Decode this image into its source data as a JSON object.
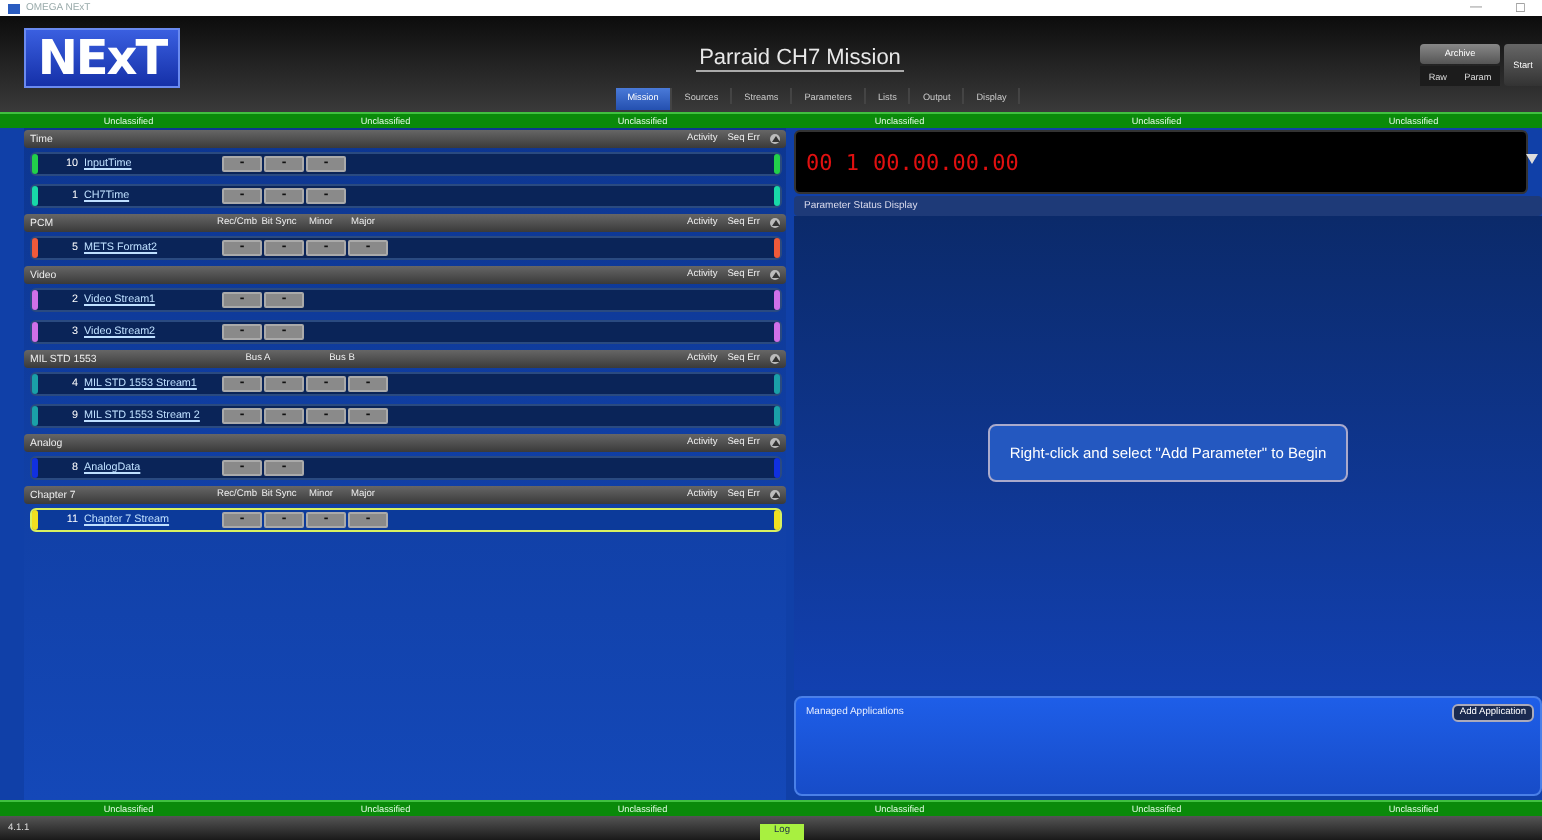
{
  "window": {
    "title": "OMEGA NExT",
    "controls": [
      "—",
      "☐"
    ]
  },
  "header": {
    "logo": "NExT",
    "mission_title": "Parraid CH7 Mission",
    "tabs": [
      {
        "label": "Mission",
        "selected": true
      },
      {
        "label": "Sources",
        "selected": false
      },
      {
        "label": "Streams",
        "selected": false
      },
      {
        "label": "Parameters",
        "selected": false
      },
      {
        "label": "Lists",
        "selected": false
      },
      {
        "label": "Output",
        "selected": false
      },
      {
        "label": "Display",
        "selected": false
      }
    ],
    "archive_button": "Archive",
    "raw_button": "Raw",
    "param_button": "Param",
    "start_button": "Start"
  },
  "classification_top": [
    "Unclassified",
    "Unclassified",
    "Unclassified",
    "Unclassified",
    "Unclassified",
    "Unclassified"
  ],
  "groups": [
    {
      "name": "Time",
      "right_columns": [
        "Activity",
        "Seq Err"
      ],
      "streams": [
        {
          "number": "10",
          "name": "InputTime",
          "color": "#22d04a",
          "selected": false,
          "buttons": [
            "-",
            "-",
            "-"
          ]
        },
        {
          "number": "1",
          "name": "CH7Time",
          "color": "#18d8a8",
          "selected": false,
          "buttons": [
            "-",
            "-",
            "-"
          ]
        }
      ]
    },
    {
      "name": "PCM",
      "columns": [
        "Rec/Cmb",
        "Bit Sync",
        "Minor",
        "Major"
      ],
      "right_columns": [
        "Activity",
        "Seq Err"
      ],
      "streams": [
        {
          "number": "5",
          "name": "METS Format2",
          "color": "#f05a3a",
          "selected": false,
          "buttons": [
            "-",
            "-",
            "-",
            "-"
          ]
        }
      ]
    },
    {
      "name": "Video",
      "right_columns": [
        "Activity",
        "Seq Err"
      ],
      "streams": [
        {
          "number": "2",
          "name": "Video Stream1",
          "color": "#d070e8",
          "selected": false,
          "buttons": [
            "-",
            "-"
          ]
        },
        {
          "number": "3",
          "name": "Video Stream2",
          "color": "#d070e8",
          "selected": false,
          "buttons": [
            "-",
            "-"
          ]
        }
      ]
    },
    {
      "name": "MIL STD 1553",
      "columns": [
        "Bus A",
        "Bus B"
      ],
      "right_columns": [
        "Activity",
        "Seq Err"
      ],
      "streams": [
        {
          "number": "4",
          "name": "MIL STD 1553 Stream1",
          "color": "#1aa0a8",
          "selected": false,
          "buttons": [
            "-",
            "-",
            "-",
            "-"
          ]
        },
        {
          "number": "9",
          "name": "MIL STD 1553 Stream 2",
          "color": "#1aa0a8",
          "selected": false,
          "buttons": [
            "-",
            "-",
            "-",
            "-"
          ]
        }
      ]
    },
    {
      "name": "Analog",
      "right_columns": [
        "Activity",
        "Seq Err"
      ],
      "streams": [
        {
          "number": "8",
          "name": "AnalogData",
          "color": "#1030e0",
          "selected": false,
          "buttons": [
            "-",
            "-"
          ]
        }
      ]
    },
    {
      "name": "Chapter 7",
      "columns": [
        "Rec/Cmb",
        "Bit Sync",
        "Minor",
        "Major"
      ],
      "right_columns": [
        "Activity",
        "Seq Err"
      ],
      "streams": [
        {
          "number": "11",
          "name": "Chapter 7 Stream",
          "color": "#f0e020",
          "selected": true,
          "buttons": [
            "-",
            "-",
            "-",
            "-"
          ]
        }
      ]
    }
  ],
  "clock": {
    "channel": "00 1",
    "time": "00.00.00.00"
  },
  "parameter_status": {
    "title": "Parameter Status Display",
    "message": "Right-click and select \"Add Parameter\" to Begin"
  },
  "managed_applications": {
    "title": "Managed Applications",
    "add_button": "Add Application"
  },
  "classification_bottom": [
    "Unclassified",
    "Unclassified",
    "Unclassified",
    "Unclassified",
    "Unclassified",
    "Unclassified"
  ],
  "footer": {
    "version": "4.1.1",
    "log_button": "Log"
  }
}
